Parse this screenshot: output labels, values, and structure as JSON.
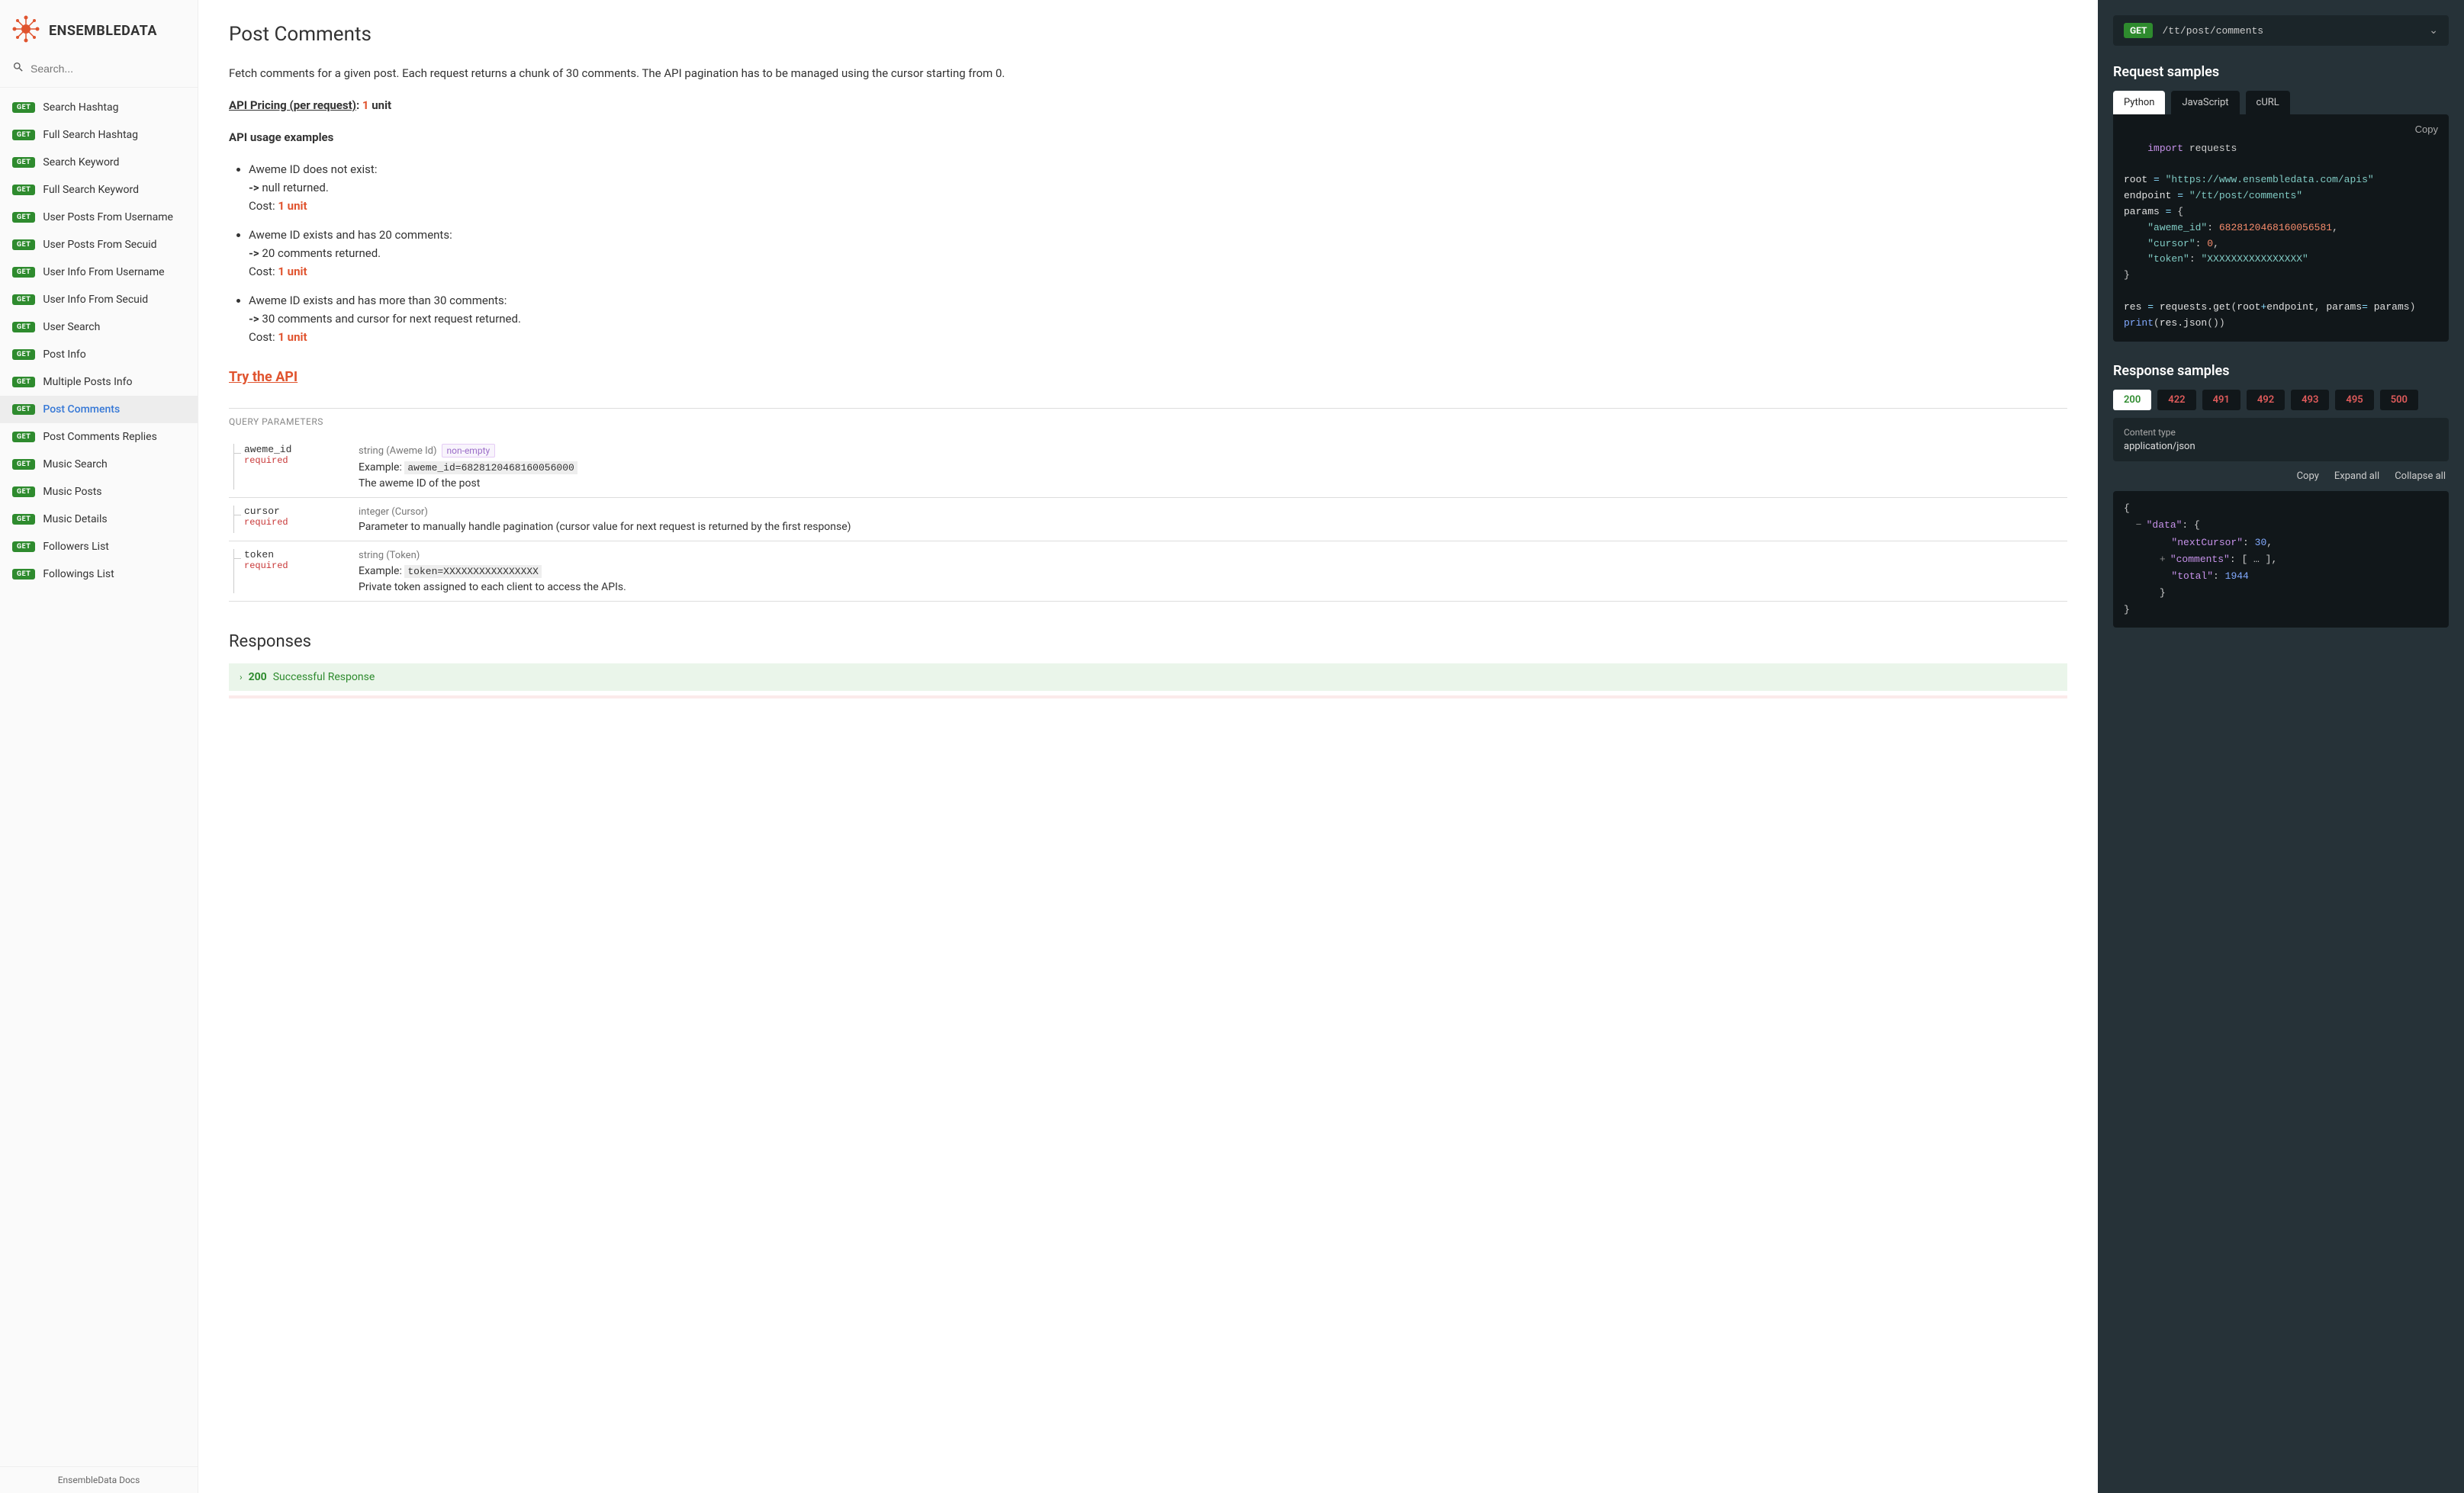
{
  "brand": "ENSEMBLEDATA",
  "search": {
    "placeholder": "Search..."
  },
  "nav": {
    "items": [
      {
        "method": "GET",
        "label": "Search Hashtag"
      },
      {
        "method": "GET",
        "label": "Full Search Hashtag"
      },
      {
        "method": "GET",
        "label": "Search Keyword"
      },
      {
        "method": "GET",
        "label": "Full Search Keyword"
      },
      {
        "method": "GET",
        "label": "User Posts From Username"
      },
      {
        "method": "GET",
        "label": "User Posts From Secuid"
      },
      {
        "method": "GET",
        "label": "User Info From Username"
      },
      {
        "method": "GET",
        "label": "User Info From Secuid"
      },
      {
        "method": "GET",
        "label": "User Search"
      },
      {
        "method": "GET",
        "label": "Post Info"
      },
      {
        "method": "GET",
        "label": "Multiple Posts Info"
      },
      {
        "method": "GET",
        "label": "Post Comments"
      },
      {
        "method": "GET",
        "label": "Post Comments Replies"
      },
      {
        "method": "GET",
        "label": "Music Search"
      },
      {
        "method": "GET",
        "label": "Music Posts"
      },
      {
        "method": "GET",
        "label": "Music Details"
      },
      {
        "method": "GET",
        "label": "Followers List"
      },
      {
        "method": "GET",
        "label": "Followings List"
      }
    ],
    "active_index": 11,
    "footer": "EnsembleData Docs"
  },
  "page": {
    "title": "Post Comments",
    "intro": "Fetch comments for a given post. Each request returns a chunk of 30 comments. The API pagination has to be managed using the cursor starting from 0.",
    "pricing_label": "API Pricing (per request)",
    "pricing_colon": ": ",
    "pricing_value": "1",
    "pricing_unit": " unit",
    "usage_heading": "API usage examples",
    "examples": [
      {
        "title": "Aweme ID does not exist:",
        "result": "null returned.",
        "cost_label": "Cost: ",
        "cost": "1 unit"
      },
      {
        "title": "Aweme ID exists and has 20 comments:",
        "result": "20 comments returned.",
        "cost_label": "Cost: ",
        "cost": "1 unit"
      },
      {
        "title": "Aweme ID exists and has more than 30 comments:",
        "result": "30 comments and cursor for next request returned.",
        "cost_label": "Cost: ",
        "cost": "1 unit"
      }
    ],
    "arrow": "-> ",
    "try_link": "Try the API",
    "query_params_label": "QUERY PARAMETERS",
    "params": [
      {
        "name": "aweme_id",
        "required": "required",
        "type": "string (Aweme Id)",
        "chip": "non-empty",
        "example_label": "Example: ",
        "example": "aweme_id=6828120468160056000",
        "desc": "The aweme ID of the post"
      },
      {
        "name": "cursor",
        "required": "required",
        "type": "integer (Cursor)",
        "chip": "",
        "example_label": "",
        "example": "",
        "desc": "Parameter to manually handle pagination (cursor value for next request is returned by the first response)"
      },
      {
        "name": "token",
        "required": "required",
        "type": "string (Token)",
        "chip": "",
        "example_label": "Example: ",
        "example": "token=XXXXXXXXXXXXXXXX",
        "desc": "Private token assigned to each client to access the APIs."
      }
    ],
    "responses_heading": "Responses",
    "success_code": "200",
    "success_text": " Successful Response"
  },
  "right": {
    "endpoint": {
      "method": "GET",
      "path": "/tt/post/comments"
    },
    "request_samples_heading": "Request samples",
    "sample_tabs": [
      "Python",
      "JavaScript",
      "cURL"
    ],
    "sample_active": 0,
    "copy_label": "Copy",
    "code": {
      "import_kw": "import",
      "import_mod": " requests",
      "root_var": "root ",
      "eq": "= ",
      "root_val": "\"https://www.ensembledata.com/apis\"",
      "endpoint_var": "endpoint ",
      "endpoint_val": "\"/tt/post/comments\"",
      "params_var": "params ",
      "brace_open": "{",
      "k1": "\"aweme_id\"",
      "colon": ": ",
      "v1": "6828120468160056581",
      "comma": ",",
      "k2": "\"cursor\"",
      "v2": "0",
      "k3": "\"token\"",
      "v3": "\"XXXXXXXXXXXXXXXX\"",
      "brace_close": "}",
      "res_var": "res ",
      "requests_get": "requests.get",
      "paren_open": "(",
      "root_ref": "root",
      "plus": "+",
      "endpoint_ref": "endpoint",
      "sep": ", ",
      "params_kw": "params",
      "params_ref": "params",
      "paren_close": ")",
      "print_fn": "print",
      "res_json": "res.json",
      "empty_call": "()"
    },
    "response_samples_heading": "Response samples",
    "resp_codes": [
      "200",
      "422",
      "491",
      "492",
      "493",
      "495",
      "500"
    ],
    "resp_active": 0,
    "content_type_label": "Content type",
    "content_type_value": "application/json",
    "json_actions": {
      "copy": "Copy",
      "expand": "Expand all",
      "collapse": "Collapse all"
    },
    "json": {
      "open": "{",
      "data_key": "\"data\"",
      "data_open": "{",
      "next_key": "\"nextCursor\"",
      "next_val": "30",
      "comments_key": "\"comments\"",
      "comments_val": "[ … ]",
      "total_key": "\"total\"",
      "total_val": "1944",
      "data_close": "}",
      "close": "}"
    }
  }
}
